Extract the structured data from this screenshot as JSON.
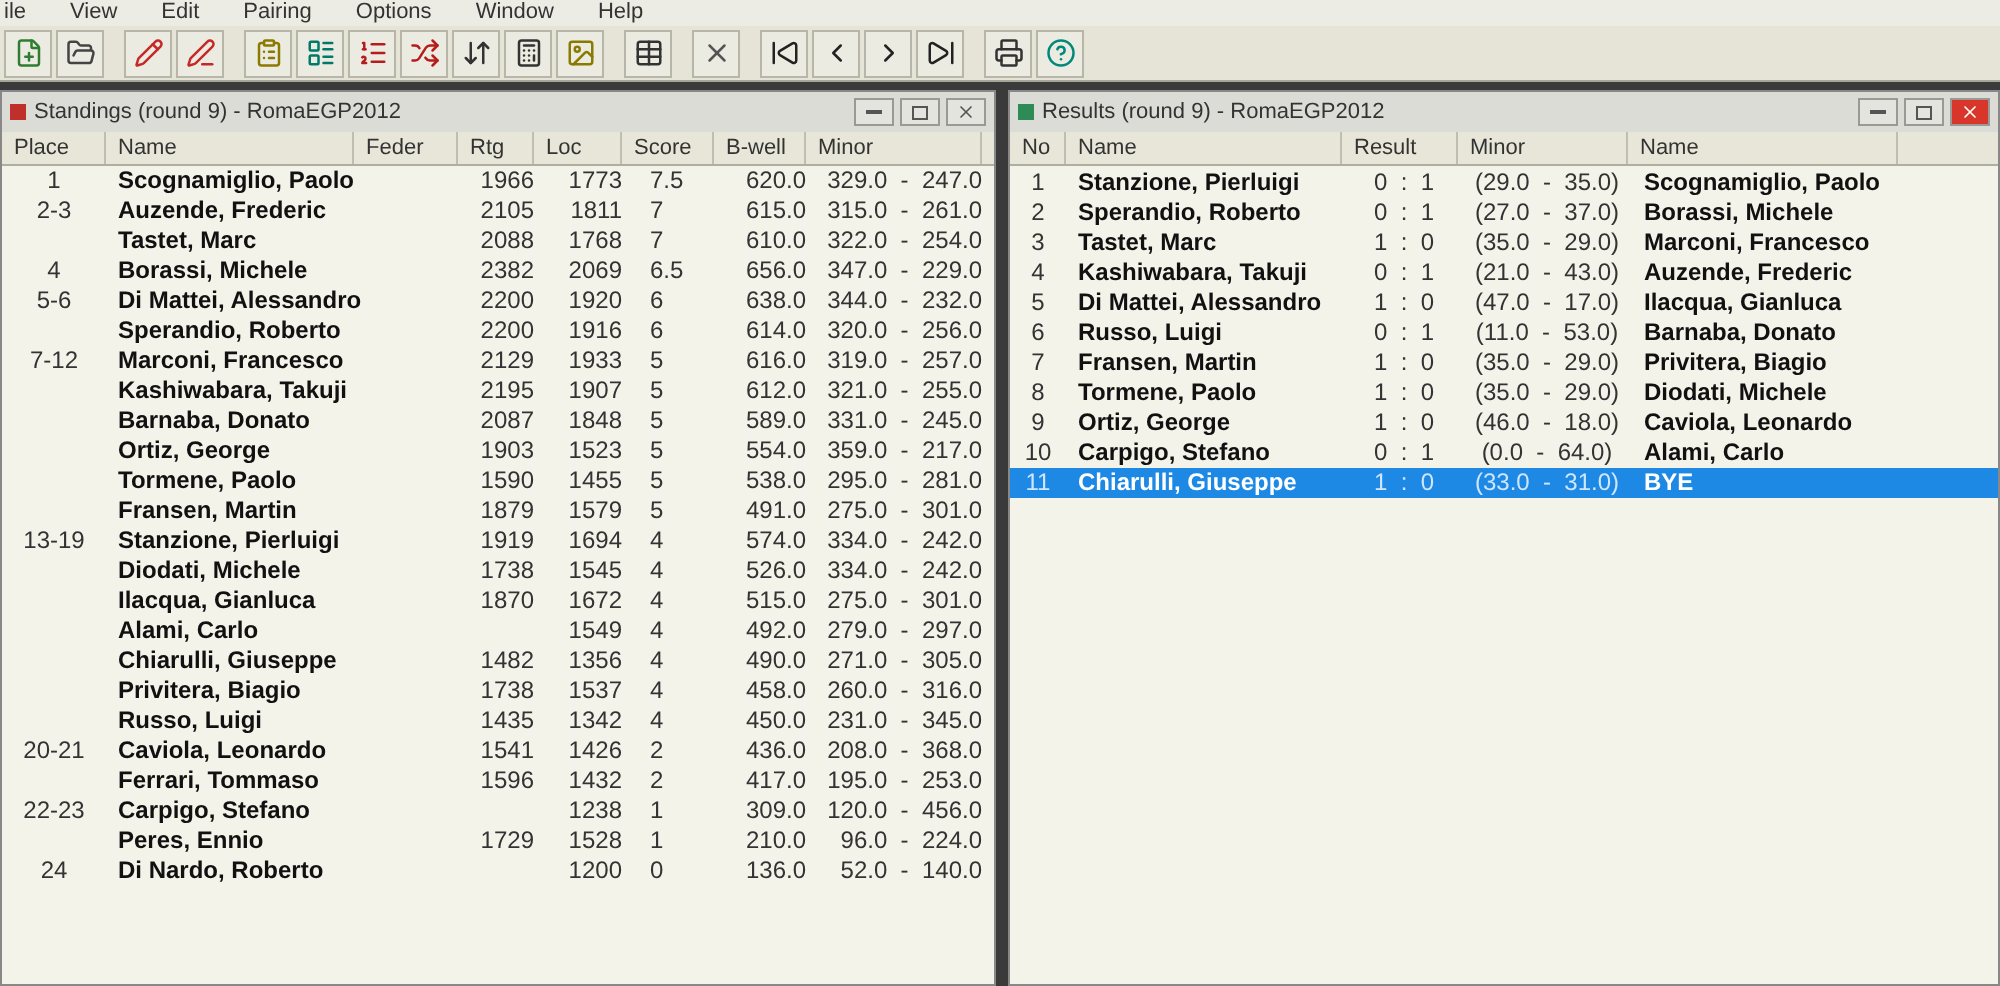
{
  "menu": [
    "ile",
    "View",
    "Edit",
    "Pairing",
    "Options",
    "Window",
    "Help"
  ],
  "standings": {
    "title": "Standings  (round 9) - RomaEGP2012",
    "columns": [
      "Place",
      "Name",
      "Feder",
      "Rtg",
      "Loc",
      "Score",
      "B-well",
      "Minor"
    ],
    "rows": [
      {
        "place": "1",
        "name": "Scognamiglio, Paolo",
        "rtg": "1966",
        "loc": "1773",
        "score": "7.5",
        "bwell": "620.0",
        "minor": "329.0  -  247.0"
      },
      {
        "place": "2-3",
        "name": "Auzende, Frederic",
        "rtg": "2105",
        "loc": "1811",
        "score": "7",
        "bwell": "615.0",
        "minor": "315.0  -  261.0"
      },
      {
        "name": "Tastet, Marc",
        "rtg": "2088",
        "loc": "1768",
        "score": "7",
        "bwell": "610.0",
        "minor": "322.0  -  254.0"
      },
      {
        "place": "4",
        "name": "Borassi, Michele",
        "rtg": "2382",
        "loc": "2069",
        "score": "6.5",
        "bwell": "656.0",
        "minor": "347.0  -  229.0"
      },
      {
        "place": "5-6",
        "name": "Di Mattei, Alessandro",
        "rtg": "2200",
        "loc": "1920",
        "score": "6",
        "bwell": "638.0",
        "minor": "344.0  -  232.0"
      },
      {
        "name": "Sperandio, Roberto",
        "rtg": "2200",
        "loc": "1916",
        "score": "6",
        "bwell": "614.0",
        "minor": "320.0  -  256.0"
      },
      {
        "place": "7-12",
        "name": "Marconi, Francesco",
        "rtg": "2129",
        "loc": "1933",
        "score": "5",
        "bwell": "616.0",
        "minor": "319.0  -  257.0"
      },
      {
        "name": "Kashiwabara, Takuji",
        "rtg": "2195",
        "loc": "1907",
        "score": "5",
        "bwell": "612.0",
        "minor": "321.0  -  255.0"
      },
      {
        "name": "Barnaba, Donato",
        "rtg": "2087",
        "loc": "1848",
        "score": "5",
        "bwell": "589.0",
        "minor": "331.0  -  245.0"
      },
      {
        "name": "Ortiz, George",
        "rtg": "1903",
        "loc": "1523",
        "score": "5",
        "bwell": "554.0",
        "minor": "359.0  -  217.0"
      },
      {
        "name": "Tormene, Paolo",
        "rtg": "1590",
        "loc": "1455",
        "score": "5",
        "bwell": "538.0",
        "minor": "295.0  -  281.0"
      },
      {
        "name": "Fransen, Martin",
        "rtg": "1879",
        "loc": "1579",
        "score": "5",
        "bwell": "491.0",
        "minor": "275.0  -  301.0"
      },
      {
        "place": "13-19",
        "name": "Stanzione, Pierluigi",
        "rtg": "1919",
        "loc": "1694",
        "score": "4",
        "bwell": "574.0",
        "minor": "334.0  -  242.0"
      },
      {
        "name": "Diodati, Michele",
        "rtg": "1738",
        "loc": "1545",
        "score": "4",
        "bwell": "526.0",
        "minor": "334.0  -  242.0"
      },
      {
        "name": "Ilacqua, Gianluca",
        "rtg": "1870",
        "loc": "1672",
        "score": "4",
        "bwell": "515.0",
        "minor": "275.0  -  301.0"
      },
      {
        "name": "Alami, Carlo",
        "loc": "1549",
        "score": "4",
        "bwell": "492.0",
        "minor": "279.0  -  297.0"
      },
      {
        "name": "Chiarulli, Giuseppe",
        "rtg": "1482",
        "loc": "1356",
        "score": "4",
        "bwell": "490.0",
        "minor": "271.0  -  305.0"
      },
      {
        "name": "Privitera, Biagio",
        "rtg": "1738",
        "loc": "1537",
        "score": "4",
        "bwell": "458.0",
        "minor": "260.0  -  316.0"
      },
      {
        "name": "Russo, Luigi",
        "rtg": "1435",
        "loc": "1342",
        "score": "4",
        "bwell": "450.0",
        "minor": "231.0  -  345.0"
      },
      {
        "place": "20-21",
        "name": "Caviola, Leonardo",
        "rtg": "1541",
        "loc": "1426",
        "score": "2",
        "bwell": "436.0",
        "minor": "208.0  -  368.0"
      },
      {
        "name": "Ferrari, Tommaso",
        "rtg": "1596",
        "loc": "1432",
        "score": "2",
        "bwell": "417.0",
        "minor": "195.0  -  253.0"
      },
      {
        "place": "22-23",
        "name": "Carpigo, Stefano",
        "loc": "1238",
        "score": "1",
        "bwell": "309.0",
        "minor": "120.0  -  456.0"
      },
      {
        "name": "Peres, Ennio",
        "rtg": "1729",
        "loc": "1528",
        "score": "1",
        "bwell": "210.0",
        "minor": "96.0  -  224.0"
      },
      {
        "place": "24",
        "name": "Di Nardo, Roberto",
        "loc": "1200",
        "score": "0",
        "bwell": "136.0",
        "minor": "52.0  -  140.0"
      }
    ]
  },
  "results": {
    "title": "Results  (round 9) - RomaEGP2012",
    "columns": [
      "No",
      "Name",
      "Result",
      "Minor",
      "Name"
    ],
    "rows": [
      {
        "no": "1",
        "white": "Stanzione, Pierluigi",
        "result": "0  :  1",
        "minor": "(29.0  -  35.0)",
        "black": "Scognamiglio, Paolo",
        "selected": false
      },
      {
        "no": "2",
        "white": "Sperandio, Roberto",
        "result": "0  :  1",
        "minor": "(27.0  -  37.0)",
        "black": "Borassi, Michele",
        "selected": false
      },
      {
        "no": "3",
        "white": "Tastet, Marc",
        "result": "1  :  0",
        "minor": "(35.0  -  29.0)",
        "black": "Marconi, Francesco",
        "selected": false
      },
      {
        "no": "4",
        "white": "Kashiwabara, Takuji",
        "result": "0  :  1",
        "minor": "(21.0  -  43.0)",
        "black": "Auzende, Frederic",
        "selected": false
      },
      {
        "no": "5",
        "white": "Di Mattei, Alessandro",
        "result": "1  :  0",
        "minor": "(47.0  -  17.0)",
        "black": "Ilacqua, Gianluca",
        "selected": false
      },
      {
        "no": "6",
        "white": "Russo, Luigi",
        "result": "0  :  1",
        "minor": "(11.0  -  53.0)",
        "black": "Barnaba, Donato",
        "selected": false
      },
      {
        "no": "7",
        "white": "Fransen, Martin",
        "result": "1  :  0",
        "minor": "(35.0  -  29.0)",
        "black": "Privitera, Biagio",
        "selected": false
      },
      {
        "no": "8",
        "white": "Tormene, Paolo",
        "result": "1  :  0",
        "minor": "(35.0  -  29.0)",
        "black": "Diodati, Michele",
        "selected": false
      },
      {
        "no": "9",
        "white": "Ortiz, George",
        "result": "1  :  0",
        "minor": "(46.0  -  18.0)",
        "black": "Caviola, Leonardo",
        "selected": false
      },
      {
        "no": "10",
        "white": "Carpigo, Stefano",
        "result": "0  :  1",
        "minor": "(0.0  -  64.0)",
        "black": "Alami, Carlo",
        "selected": false
      },
      {
        "no": "11",
        "white": "Chiarulli, Giuseppe",
        "result": "1  :  0",
        "minor": "(33.0  -  31.0)",
        "black": "BYE",
        "selected": true
      }
    ]
  }
}
